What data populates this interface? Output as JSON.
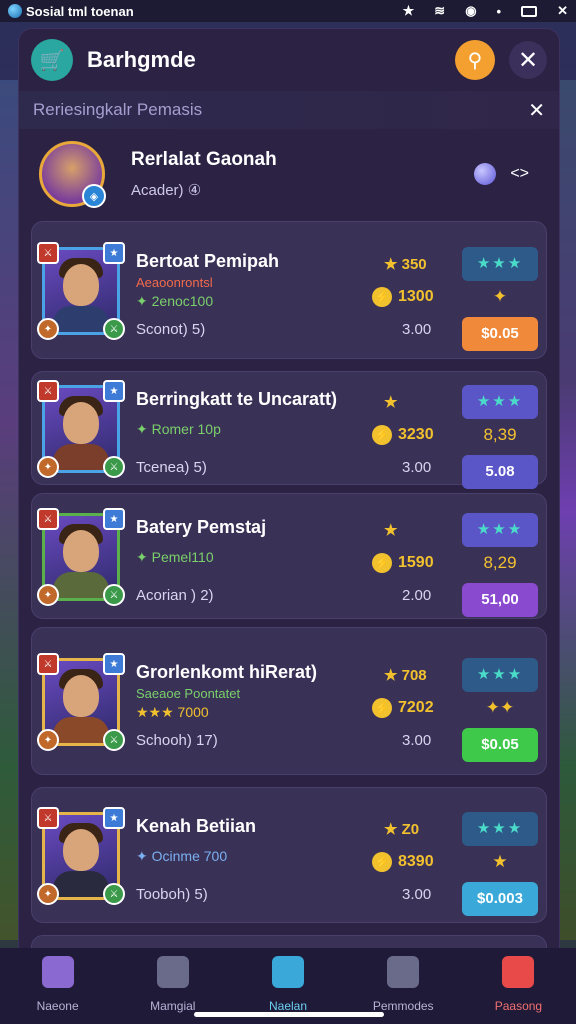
{
  "status_bar": {
    "app_name": "Sosial tml toenan"
  },
  "header": {
    "title": "Barhgmde"
  },
  "subheader": {
    "text": "Reriesingkalr Pemasis"
  },
  "profile": {
    "name": "Rerlalat Gaonah",
    "sub": "Acader) ④"
  },
  "cards": [
    {
      "title": "Bertoat Pemipah",
      "sub": "Aeaoonrontsl",
      "stat": "✦ 2enoc100",
      "meta": "Sconot) 5)",
      "star": "★ 350",
      "coins": "1300",
      "price": "3.00",
      "rstars": "★★★",
      "rmid": "✦",
      "btn": "$0.05",
      "btn_color": "#f08a3a",
      "rtop_color": "#2e5a8a",
      "frame": "#4aa3e6",
      "sub_color": "#f26a4a",
      "stat_color": "#7ad06a"
    },
    {
      "title": "Berringkatt te Uncaratt)",
      "sub": "",
      "stat": "✦ Romer 10p",
      "meta": "Tcenea) 5)",
      "star": "★",
      "coins": "3230",
      "price": "3.00",
      "rstars": "★★★",
      "rmid": "8,39",
      "btn": "5.08",
      "btn_color": "#5a56c8",
      "rtop_color": "#5a56c8",
      "frame": "#4aa3e6",
      "sub_color": "#f26a4a",
      "stat_color": "#7ad06a"
    },
    {
      "title": "Batery Pemstaj",
      "sub": "",
      "stat": "✦ Pemel110",
      "meta": "Acorian ) 2)",
      "star": "★",
      "coins": "1590",
      "price": "2.00",
      "rstars": "★★★",
      "rmid": "8,29",
      "btn": "51,00",
      "btn_color": "#8a4ad0",
      "rtop_color": "#5a56c8",
      "frame": "#5ab04a",
      "sub_color": "#f26a4a",
      "stat_color": "#7ad06a"
    },
    {
      "title": "Grorlenkomt hiRerat)",
      "sub": "Saeaoe Poontatet",
      "stat": "★★★ 7000",
      "meta": "Schooh) 17)",
      "star": "★ 708",
      "coins": "7202",
      "price": "3.00",
      "rstars": "★★★",
      "rmid": "✦✦",
      "btn": "$0.05",
      "btn_color": "#3ec94a",
      "rtop_color": "#2e5a8a",
      "frame": "#e6b54a",
      "sub_color": "#7ad06a",
      "stat_color": "#f2c12e"
    },
    {
      "title": "Kenah Betiian",
      "sub": "",
      "stat": "✦ Ocinme 700",
      "meta": "Tooboh) 5)",
      "star": "★ Z0",
      "coins": "8390",
      "price": "3.00",
      "rstars": "★★★",
      "rmid": "★",
      "btn": "$0.003",
      "btn_color": "#3aa8d8",
      "rtop_color": "#2e5a8a",
      "frame": "#e6b54a",
      "sub_color": "#f26a4a",
      "stat_color": "#7ab0f0"
    }
  ],
  "nav": [
    {
      "label": "Naeone",
      "color": "#8a6ad0"
    },
    {
      "label": "Mamgial",
      "color": "#6a6a8a"
    },
    {
      "label": "Naelan",
      "color": "#3aa8d8"
    },
    {
      "label": "Pemmodes",
      "color": "#6a6a8a"
    },
    {
      "label": "Paasong",
      "color": "#e84a4a"
    }
  ]
}
